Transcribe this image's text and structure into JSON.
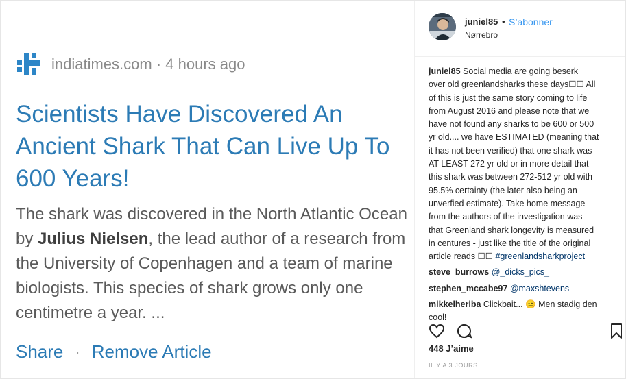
{
  "article": {
    "source": "indiatimes.com · 4 hours ago",
    "headline_lines": [
      "Scientists Have Discovered An",
      "Ancient Shark That Can Live Up To",
      "600 Years!"
    ],
    "summary": {
      "line1": "The shark was discovered in the North Atlantic Ocean",
      "line2_prefix": "by ",
      "line2_name": "Julius Nielsen",
      "line2_suffix": ", the lead author of a research from",
      "line3": "the University of Copenhagen and a team of marine",
      "line4": "biologists. This species of shark grows only one",
      "line5": "centimetre a year. ..."
    },
    "share_label": "Share",
    "separator": "·",
    "remove_label": "Remove Article",
    "accent_color": "#2c7bb5"
  },
  "post": {
    "username": "juniel85",
    "bullet": "•",
    "follow_label": "S’abonner",
    "location": "Nørrebro",
    "caption_user": "juniel85",
    "caption_lines": [
      "Social media are going beserk",
      "over old greenlandsharks these days☐☐ All",
      "of this is just the same story coming to life",
      "from August 2016 and please note that we",
      "have not found any sharks to be 600 or 500",
      "yr old.... we have ESTIMATED (meaning that",
      "it has not been verified) that one shark was",
      "AT LEAST 272 yr old or in more detail that",
      "this shark was between 272-512 yr old with",
      "95.5% certainty (the later also being an",
      "unverfied estimate). Take home message",
      "from the authors of the investigation was",
      "that Greenland shark longevity is measured",
      "in centures - just like the title of the original"
    ],
    "caption_last_prefix": "article reads ☐☐ ",
    "caption_hashtag": "#greenlandsharkproject",
    "comments": [
      {
        "user": "steve_burrows",
        "mention": "@_dicks_pics_"
      },
      {
        "user": "stephen_mccabe97",
        "mention": "@maxshtevens"
      }
    ],
    "comment3_user": "mikkelheriba",
    "comment3_text_line1": "Clickbait... 😐 Men stadig den",
    "comment3_text_line2": "cool!",
    "likes": "448 J’aime",
    "time": "IL Y A 3 JOURS",
    "icons": [
      "heart-icon",
      "comment-icon",
      "bookmark-icon"
    ],
    "link_color": "#3897f0"
  }
}
